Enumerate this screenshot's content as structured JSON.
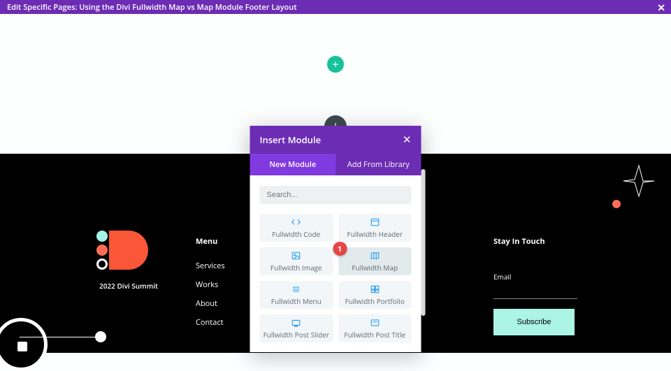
{
  "header": {
    "title": "Edit Specific Pages: Using the Divi Fullwidth Map vs Map Module Footer Layout"
  },
  "footer": {
    "site_name": "2022 Divi Summit",
    "menu_heading": "Menu",
    "menu_items": [
      "Services",
      "Works",
      "About",
      "Contact"
    ],
    "stay_heading": "Stay In Touch",
    "email_label": "Email",
    "subscribe_label": "Subscribe"
  },
  "modal": {
    "title": "Insert Module",
    "tabs": {
      "new": "New Module",
      "library": "Add From Library"
    },
    "search_placeholder": "Search...",
    "badge_number": "1",
    "modules": [
      {
        "label": "Fullwidth Code",
        "icon": "code"
      },
      {
        "label": "Fullwidth Header",
        "icon": "header"
      },
      {
        "label": "Fullwidth Image",
        "icon": "image"
      },
      {
        "label": "Fullwidth Map",
        "icon": "map",
        "highlight": true,
        "badge": true
      },
      {
        "label": "Fullwidth Menu",
        "icon": "menu"
      },
      {
        "label": "Fullwidth Portfolio",
        "icon": "portfolio"
      },
      {
        "label": "Fullwidth Post Slider",
        "icon": "slider"
      },
      {
        "label": "Fullwidth Post Title",
        "icon": "title"
      }
    ]
  },
  "colors": {
    "purple": "#6c2db4",
    "teal": "#16c39a",
    "mint": "#abf4e6",
    "orange": "#fe6c58",
    "red": "#e64545"
  }
}
